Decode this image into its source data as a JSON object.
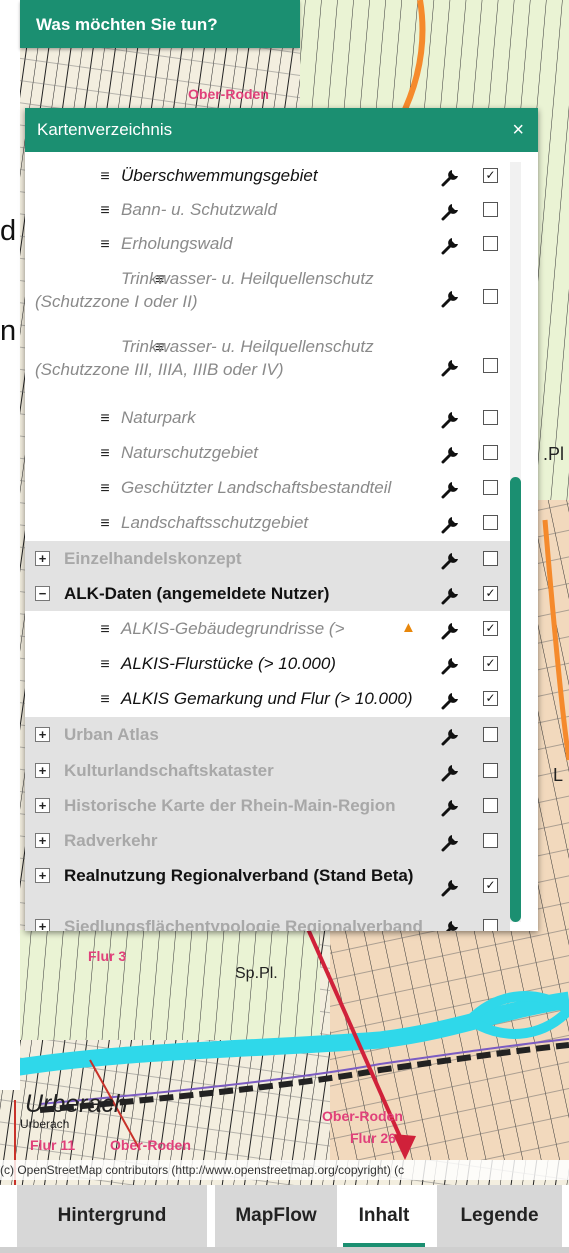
{
  "header": {
    "title": "Was möchten Sie tun?"
  },
  "panel": {
    "title": "Kartenverzeichnis",
    "close_label": "×",
    "rows": [
      {
        "label": "Überschwemmungsgebiet",
        "level": "sub",
        "active": true,
        "checked": true
      },
      {
        "label": "Bann- u. Schutzwald",
        "level": "sub",
        "active": false,
        "checked": false
      },
      {
        "label": "Erholungswald",
        "level": "sub",
        "active": false,
        "checked": false
      },
      {
        "label": "Trinkwasser- u. Heilquellenschutz (Schutzzone I oder II)",
        "level": "sub",
        "active": false,
        "checked": false
      },
      {
        "label": "Trinkwasser- u. Heilquellenschutz (Schutzzone III, IIIA, IIIB oder IV)",
        "level": "sub",
        "active": false,
        "checked": false
      },
      {
        "label": "Naturpark",
        "level": "sub",
        "active": false,
        "checked": false
      },
      {
        "label": "Naturschutzgebiet",
        "level": "sub",
        "active": false,
        "checked": false
      },
      {
        "label": "Geschützter Landschaftsbestandteil",
        "level": "sub",
        "active": false,
        "checked": false
      },
      {
        "label": "Landschaftsschutzgebiet",
        "level": "sub",
        "active": false,
        "checked": false
      },
      {
        "label": "Einzelhandelskonzept",
        "level": "group",
        "expand": "+",
        "active": false,
        "checked": false
      },
      {
        "label": "ALK-Daten (angemeldete Nutzer)",
        "level": "group",
        "expand": "−",
        "active": true,
        "checked": true
      },
      {
        "label": "ALKIS-Gebäudegrundrisse (>",
        "level": "sub",
        "active": false,
        "checked": true,
        "warning": "▲"
      },
      {
        "label": "ALKIS-Flurstücke (> 10.000)",
        "level": "sub",
        "active": true,
        "checked": true
      },
      {
        "label": "ALKIS Gemarkung und Flur (> 10.000)",
        "level": "sub",
        "active": true,
        "checked": true
      },
      {
        "label": "Urban Atlas",
        "level": "group",
        "expand": "+",
        "active": false,
        "checked": false
      },
      {
        "label": "Kulturlandschaftskataster",
        "level": "group",
        "expand": "+",
        "active": false,
        "checked": false
      },
      {
        "label": "Historische Karte der Rhein-Main-Region",
        "level": "group",
        "expand": "+",
        "active": false,
        "checked": false
      },
      {
        "label": "Radverkehr",
        "level": "group",
        "expand": "+",
        "active": false,
        "checked": false
      },
      {
        "label": "Realnutzung Regionalverband (Stand Beta)",
        "level": "group",
        "expand": "+",
        "active": true,
        "checked": true
      },
      {
        "label": "Siedlungsflächentypologie Regionalverband",
        "level": "group",
        "expand": "+",
        "active": false,
        "checked": false
      }
    ]
  },
  "map": {
    "labels": [
      "Ober-Roden",
      "Flur 3",
      "Sp.Pl.",
      "Urberach",
      "Urberach",
      "Flur 11",
      "Ober-Roden",
      "Ober-Roden",
      "Flur 26",
      ".Pl",
      "L"
    ],
    "attribution": "(c) OpenStreetMap contributors (http://www.openstreetmap.org/copyright) (c"
  },
  "page_fragments": [
    "d",
    "n"
  ],
  "tabs": [
    {
      "label": "Hintergrund",
      "active": false
    },
    {
      "label": "MapFlow",
      "active": false
    },
    {
      "label": "Inhalt",
      "active": true
    },
    {
      "label": "Legende",
      "active": false
    }
  ],
  "colors": {
    "accent": "#1b8f71",
    "arrow": "#d0213a",
    "river": "#2fd8ea"
  }
}
